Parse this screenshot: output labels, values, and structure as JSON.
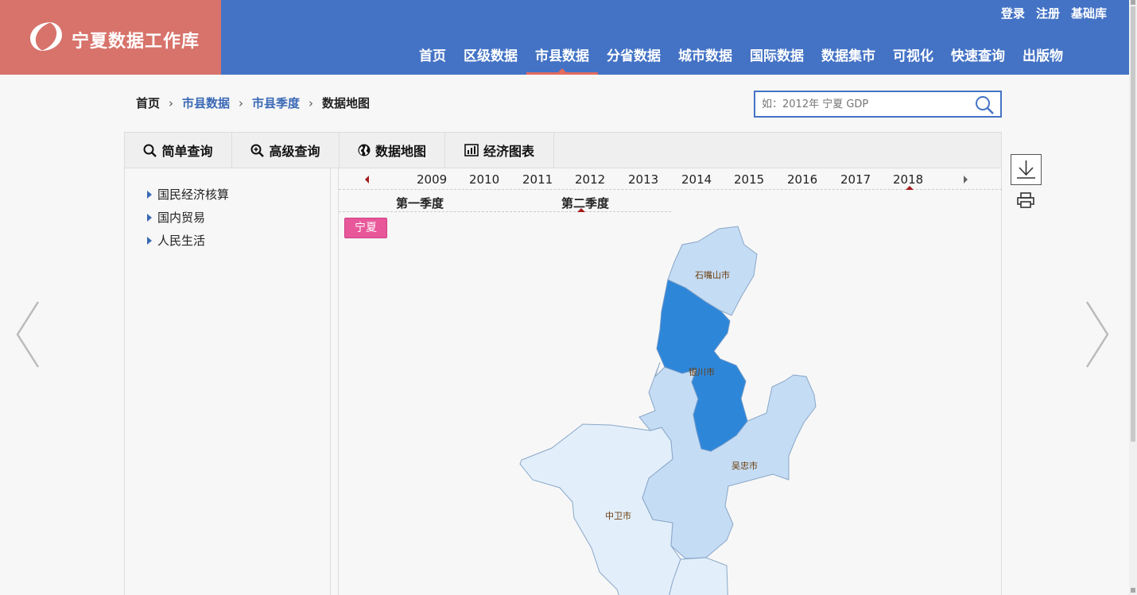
{
  "header": {
    "logo_text": "宁夏数据工作库",
    "top_links": [
      "登录",
      "注册",
      "基础库"
    ],
    "nav": [
      "首页",
      "区级数据",
      "市县数据",
      "分省数据",
      "城市数据",
      "国际数据",
      "数据集市",
      "可视化",
      "快速查询",
      "出版物"
    ],
    "active_nav": "市县数据",
    "brand_color": "#4473c5",
    "logo_color": "#d7736b"
  },
  "breadcrumb": {
    "home": "首页",
    "level1": "市县数据",
    "level2": "市县季度",
    "current": "数据地图"
  },
  "search": {
    "placeholder": "如：2012年 宁夏 GDP",
    "icon": "search-icon"
  },
  "tabs": [
    {
      "label": "简单查询",
      "icon": "search-icon"
    },
    {
      "label": "高级查询",
      "icon": "zoom-in-icon"
    },
    {
      "label": "数据地图",
      "icon": "globe-icon"
    },
    {
      "label": "经济图表",
      "icon": "bar-chart-icon"
    }
  ],
  "tree": [
    "国民经济核算",
    "国内贸易",
    "人民生活"
  ],
  "years": [
    "2009",
    "2010",
    "2011",
    "2012",
    "2013",
    "2014",
    "2015",
    "2016",
    "2017",
    "2018"
  ],
  "selected_year": "2018",
  "quarters": [
    "第一季度",
    "第二季度"
  ],
  "selected_quarter": "第二季度",
  "region_button": "宁夏",
  "map": {
    "regions": [
      {
        "name": "石嘴山市",
        "color": "#c4dcf4"
      },
      {
        "name": "银川市",
        "color": "#2e86d9"
      },
      {
        "name": "吴忠市",
        "color": "#c4dcf4"
      },
      {
        "name": "中卫市",
        "color": "#e2effb"
      }
    ]
  },
  "tools": {
    "download": "download-icon",
    "print": "printer-icon"
  }
}
